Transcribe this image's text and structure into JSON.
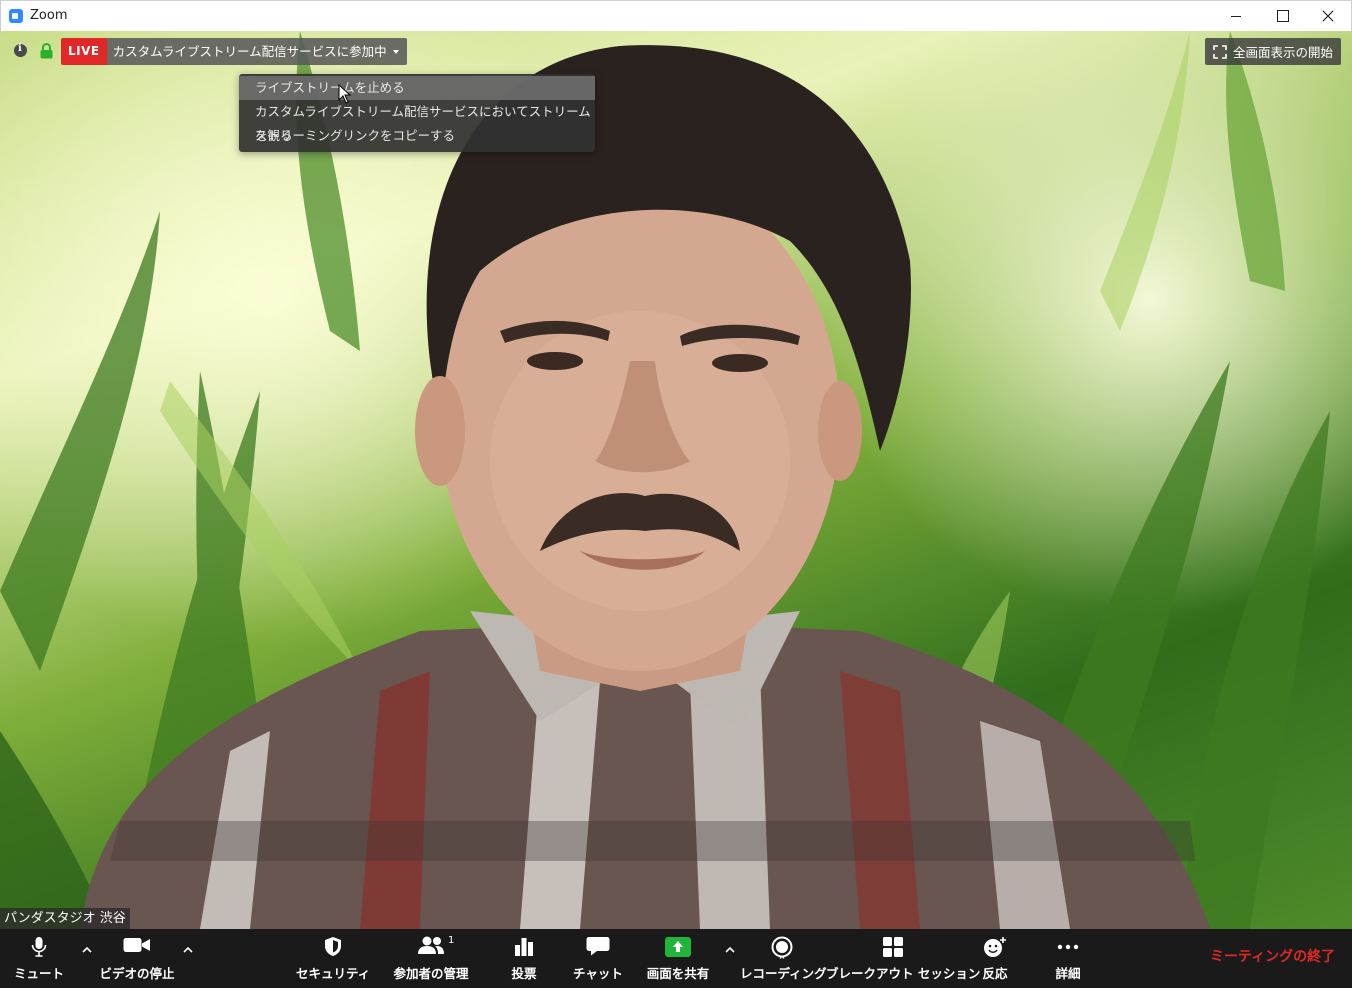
{
  "window": {
    "title": "Zoom"
  },
  "meeting": {
    "live_badge": "LIVE",
    "stream_status": "カスタムライブストリーム配信サービスに参加中",
    "fullscreen_label": "全画面表示の開始",
    "participant_name": "パンダスタジオ 渋谷"
  },
  "stream_menu": {
    "items": [
      {
        "label": "ライブストリームを止める",
        "hovered": true
      },
      {
        "label": "カスタムライブストリーム配信サービスにおいてストリームを観る",
        "hovered": false
      },
      {
        "label": "ストリーミングリンクをコピーする",
        "hovered": false
      }
    ]
  },
  "toolbar": {
    "mute": "ミュート",
    "stop_video": "ビデオの停止",
    "security": "セキュリティ",
    "participants": "参加者の管理",
    "participants_count": "1",
    "polling": "投票",
    "chat": "チャット",
    "share_screen": "画面を共有",
    "recording": "レコーディング",
    "breakout": "ブレークアウト セッション",
    "reactions": "反応",
    "more": "詳細",
    "end_meeting": "ミーティングの終了"
  },
  "colors": {
    "live_red": "#e02828",
    "share_green": "#22b33a",
    "toolbar_bg": "#1a1a1a"
  }
}
